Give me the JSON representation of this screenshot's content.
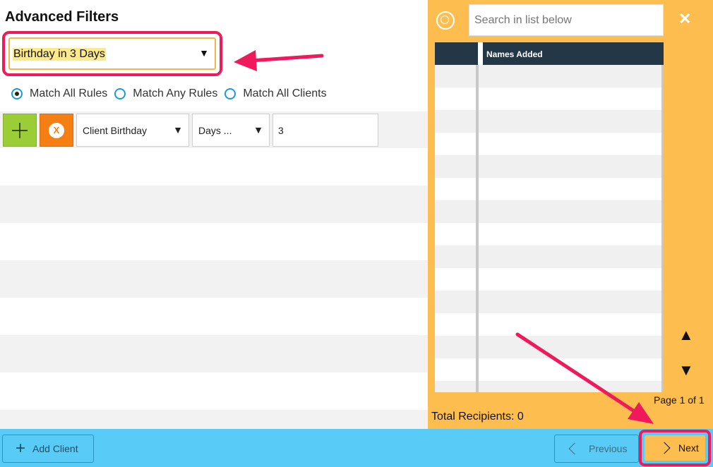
{
  "panel": {
    "title": "Advanced Filters",
    "preset": {
      "selected": "Birthday in 3 Days"
    },
    "match_options": [
      {
        "label": "Match All Rules",
        "checked": true
      },
      {
        "label": "Match Any Rules",
        "checked": false
      },
      {
        "label": "Match All Clients",
        "checked": false
      }
    ],
    "rule": {
      "field": "Client Birthday",
      "operator": "Days ...",
      "value": "3"
    }
  },
  "recipients": {
    "search_placeholder": "Search in list below",
    "column_header": "Names Added",
    "page_info": "Page 1 of 1",
    "total": "Total Recipients: 0"
  },
  "footer": {
    "add_client": "Add Client",
    "previous": "Previous",
    "next": "Next"
  },
  "colors": {
    "accent_orange": "#febe4f",
    "footer_blue": "#58ccf6",
    "add_green": "#9acd36",
    "remove_orange": "#f57f13",
    "highlight_pink": "#f0195c",
    "header_dark": "#233746"
  },
  "icons": [
    "search-icon",
    "close-icon",
    "plus-icon",
    "remove-icon",
    "chevron-up-icon",
    "chevron-down-icon",
    "chevron-left-icon",
    "chevron-right-icon"
  ]
}
